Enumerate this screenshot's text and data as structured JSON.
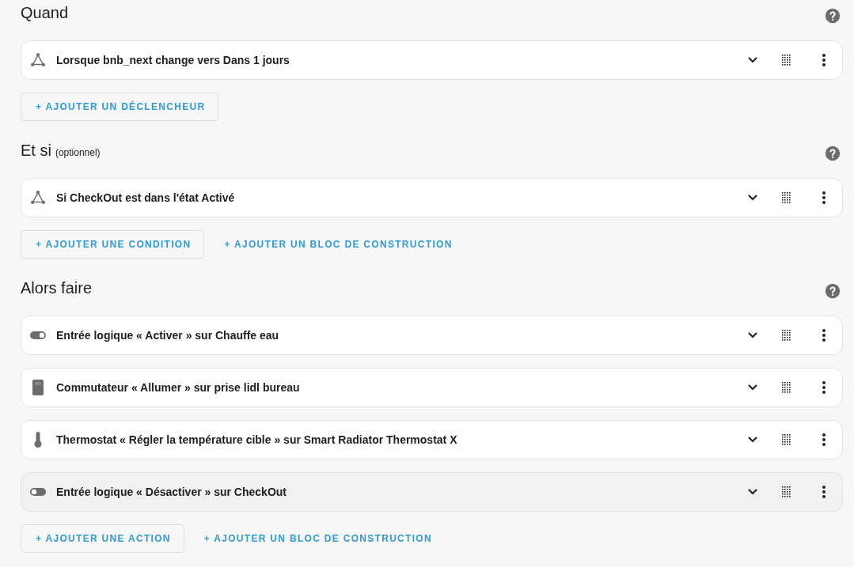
{
  "sections": [
    {
      "title": "Quand",
      "items": [
        {
          "kind": "trigger",
          "label": "Lorsque bnb_next change vers Dans 1 jours",
          "highlighted": false
        }
      ],
      "buttons": [
        {
          "kind": "outlined",
          "label": "+ AJOUTER UN DÉCLENCHEUR"
        }
      ]
    },
    {
      "title": "Et si",
      "subtitle": "(optionnel)",
      "items": [
        {
          "kind": "trigger",
          "label": "Si CheckOut est dans l'état Activé",
          "highlighted": false
        }
      ],
      "buttons": [
        {
          "kind": "outlined",
          "label": "+ AJOUTER UNE CONDITION"
        },
        {
          "kind": "text",
          "label": "+ AJOUTER UN BLOC DE CONSTRUCTION"
        }
      ]
    },
    {
      "title": "Alors faire",
      "items": [
        {
          "kind": "toggle_on",
          "label": "Entrée logique « Activer » sur Chauffe eau",
          "highlighted": false
        },
        {
          "kind": "switch",
          "label": "Commutateur « Allumer » sur prise lidl bureau",
          "highlighted": false
        },
        {
          "kind": "thermostat",
          "label": "Thermostat « Régler la température cible » sur Smart Radiator Thermostat X",
          "highlighted": false
        },
        {
          "kind": "toggle_off",
          "label": "Entrée logique « Désactiver » sur CheckOut",
          "highlighted": true
        }
      ],
      "buttons": [
        {
          "kind": "outlined",
          "label": "+ AJOUTER UNE ACTION"
        },
        {
          "kind": "text",
          "label": "+ AJOUTER UN BLOC DE CONSTRUCTION"
        }
      ]
    }
  ]
}
